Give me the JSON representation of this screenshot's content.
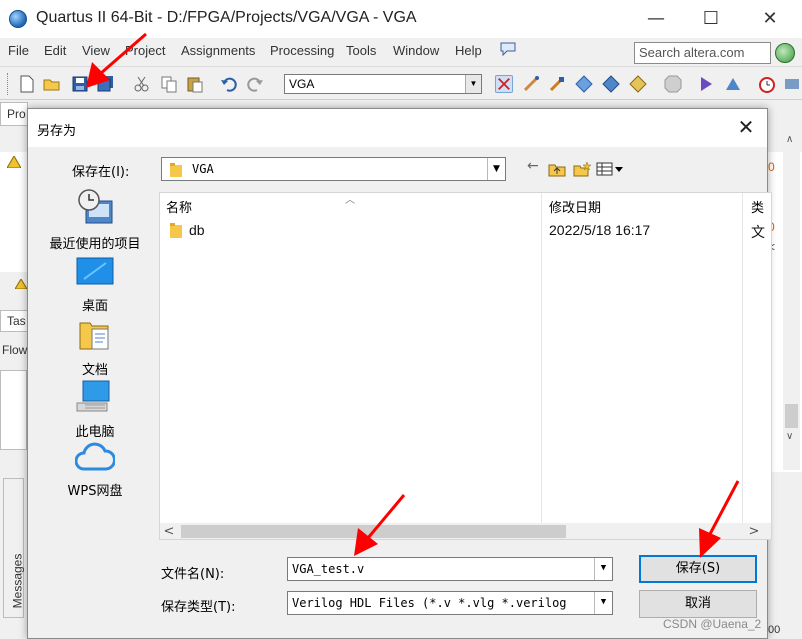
{
  "window": {
    "title": "Quartus II 64-Bit - D:/FPGA/Projects/VGA/VGA - VGA",
    "minimize": "—",
    "maximize": "☐",
    "close": "✕"
  },
  "menubar": {
    "items": [
      "File",
      "Edit",
      "View",
      "Project",
      "Assignments",
      "Processing",
      "Tools",
      "Window",
      "Help"
    ],
    "search_placeholder": "Search altera.com"
  },
  "toolbar": {
    "project_select": "VGA"
  },
  "background": {
    "proj_label": "Pro",
    "tasks_label": "Tas",
    "flow_label": "Flow",
    "messages_label": "Messages",
    "right_digits": [
      "0",
      "0",
      "<",
      ";",
      ";",
      "00"
    ]
  },
  "dialog": {
    "title": "另存为",
    "close": "✕",
    "save_in_label": "保存在(I):",
    "save_in_value": "VGA",
    "places": [
      {
        "label": "最近使用的项目",
        "icon": "recent-places-icon"
      },
      {
        "label": "桌面",
        "icon": "desktop-icon"
      },
      {
        "label": "文档",
        "icon": "documents-icon"
      },
      {
        "label": "此电脑",
        "icon": "this-pc-icon"
      },
      {
        "label": "WPS网盘",
        "icon": "wps-cloud-icon"
      }
    ],
    "columns": {
      "name": "名称",
      "modified": "修改日期",
      "type": "类"
    },
    "files": [
      {
        "name": "db",
        "modified": "2022/5/18 16:17",
        "type": "文"
      }
    ],
    "filename_label": "文件名(N):",
    "filename_value": "VGA_test.v",
    "filetype_label": "保存类型(T):",
    "filetype_value": "Verilog HDL Files (*.v *.vlg *.verilog",
    "save_button": "保存(S)",
    "cancel_button": "取消"
  },
  "watermark": "CSDN @Uaena_2",
  "colors": {
    "annotation_red": "#ff0000",
    "accent_blue": "#0078d7",
    "folder_yellow": "#f5c84c"
  }
}
